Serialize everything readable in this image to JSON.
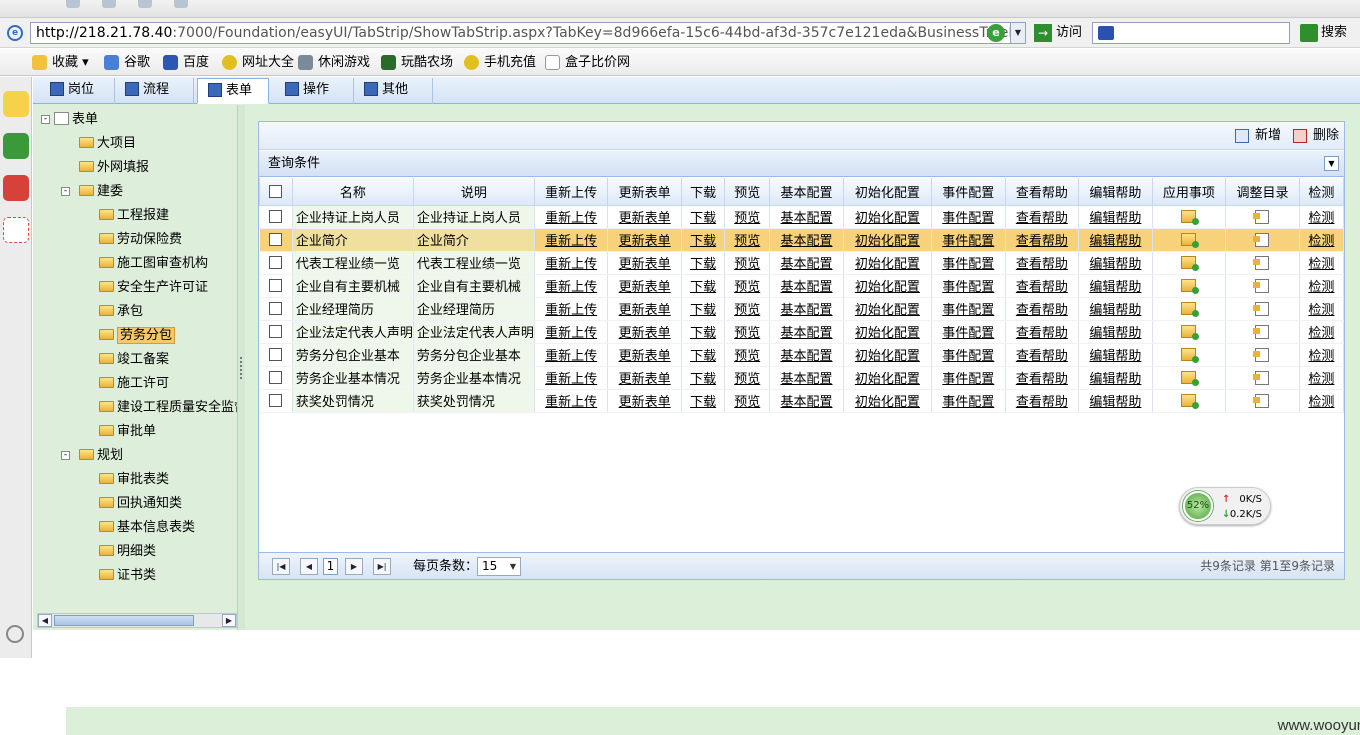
{
  "browser": {
    "url_host": "http://218.21.78.40",
    "url_rest": ":7000/Foundation/easyUI/TabStrip/ShowTabStrip.aspx?TabKey=8d966efa-15c6-44bd-af3d-357c7e121eda&BusinessTreeId=",
    "go_label": "访问",
    "search_label": "搜索"
  },
  "favorites": [
    "收藏",
    "谷歌",
    "百度",
    "网址大全",
    "休闲游戏",
    "玩酷农场",
    "手机充值",
    "盒子比价网"
  ],
  "tabs": [
    "岗位",
    "流程",
    "表单",
    "操作",
    "其他"
  ],
  "active_tab": "表单",
  "tree": {
    "root": "表单",
    "nodes": [
      "大项目",
      "外网填报",
      "建委",
      "工程报建",
      "劳动保险费",
      "施工图审查机构",
      "安全生产许可证",
      "承包",
      "劳务分包",
      "竣工备案",
      "施工许可",
      "建设工程质量安全监督",
      "审批单",
      "规划",
      "审批表类",
      "回执通知类",
      "基本信息表类",
      "明细类",
      "证书类"
    ],
    "selected": "劳务分包"
  },
  "toolbar": {
    "add_label": "新增",
    "delete_label": "删除"
  },
  "query_title": "查询条件",
  "grid": {
    "columns": [
      "名称",
      "说明",
      "重新上传",
      "更新表单",
      "下载",
      "预览",
      "基本配置",
      "初始化配置",
      "事件配置",
      "查看帮助",
      "编辑帮助",
      "应用事项",
      "调整目录",
      "检测"
    ],
    "links": [
      "重新上传",
      "更新表单",
      "下载",
      "预览",
      "基本配置",
      "初始化配置",
      "事件配置",
      "查看帮助",
      "编辑帮助"
    ],
    "check_label": "检测",
    "rows": [
      {
        "name": "企业持证上岗人员",
        "desc": "企业持证上岗人员"
      },
      {
        "name": "企业简介",
        "desc": "企业简介"
      },
      {
        "name": "代表工程业绩一览",
        "desc": "代表工程业绩一览"
      },
      {
        "name": "企业自有主要机械",
        "desc": "企业自有主要机械"
      },
      {
        "name": "企业经理简历",
        "desc": "企业经理简历"
      },
      {
        "name": "企业法定代表人声明",
        "desc": "企业法定代表人声明"
      },
      {
        "name": "劳务分包企业基本",
        "desc": "劳务分包企业基本"
      },
      {
        "name": "劳务企业基本情况",
        "desc": "劳务企业基本情况"
      },
      {
        "name": "获奖处罚情况",
        "desc": "获奖处罚情况"
      }
    ],
    "highlight_row": 1
  },
  "pager": {
    "page": "1",
    "page_size_label": "每页条数：",
    "page_size": "15",
    "info": "共9条记录 第1至9条记录"
  },
  "speed": {
    "percent": "52%",
    "up": "0K/S",
    "down": "0.2K/S"
  },
  "watermark": "www.wooyun.org"
}
